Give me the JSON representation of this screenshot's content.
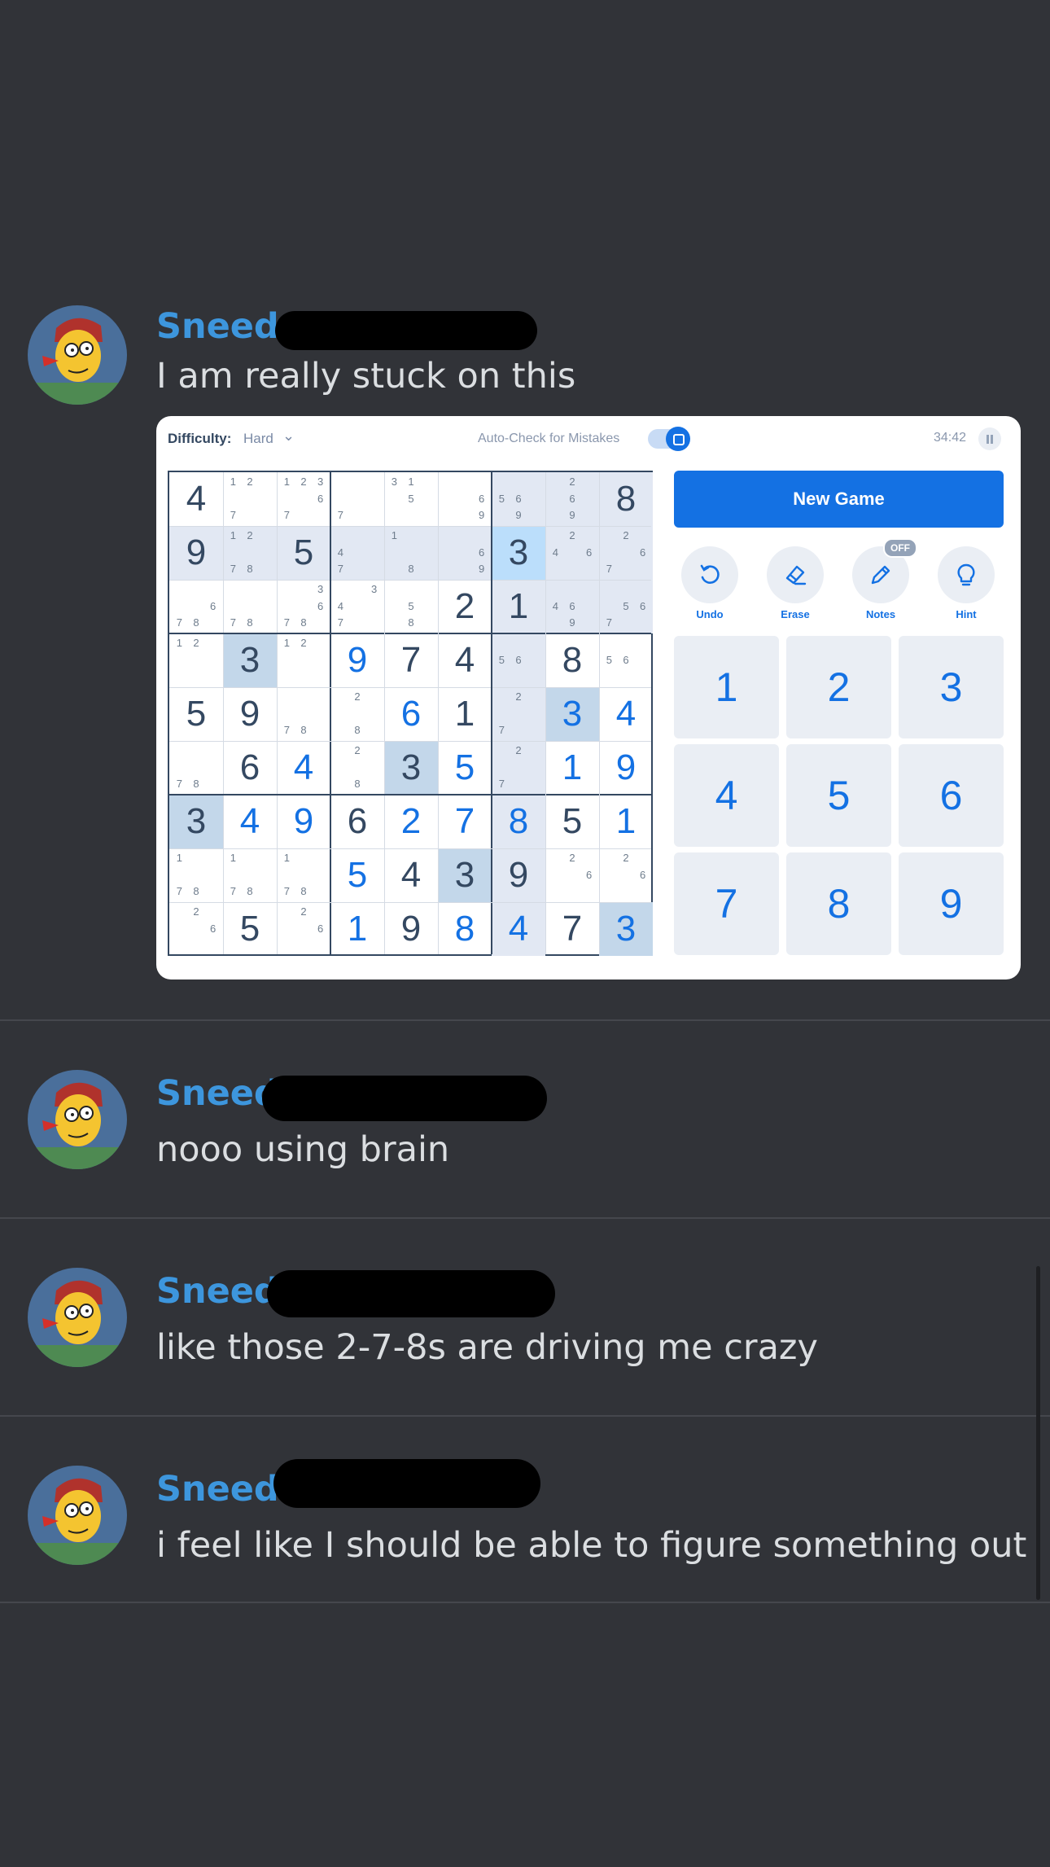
{
  "messages": [
    {
      "author": "Sneed",
      "text": "I am really stuck on this"
    },
    {
      "author": "Sneed",
      "text": "nooo using brain"
    },
    {
      "author": "Sneed",
      "text": "like those 2-7-8s are driving me crazy"
    },
    {
      "author": "Sneed",
      "text": "i feel like I should be able to figure something out"
    }
  ],
  "sudoku": {
    "difficulty_label": "Difficulty:",
    "difficulty_value": "Hard",
    "auto_check_label": "Auto-Check for Mistakes",
    "timer": "34:42",
    "new_game_label": "New Game",
    "tools": [
      {
        "label": "Undo",
        "icon": "undo-icon"
      },
      {
        "label": "Erase",
        "icon": "eraser-icon"
      },
      {
        "label": "Notes",
        "icon": "pencil-icon",
        "badge": "OFF"
      },
      {
        "label": "Hint",
        "icon": "lightbulb-icon"
      }
    ],
    "numpad": [
      "1",
      "2",
      "3",
      "4",
      "5",
      "6",
      "7",
      "8",
      "9"
    ],
    "colors": {
      "given": "#344861",
      "entered": "#1471e3",
      "highlight": "#e2e8f3",
      "selected_same": "#c3d7ea",
      "selected": "#bbdefb"
    },
    "cells": [
      [
        {
          "v": "4",
          "k": "g"
        },
        {
          "n": [
            "1",
            "2",
            "",
            "",
            "",
            "",
            "7",
            "",
            ""
          ]
        },
        {
          "n": [
            "1",
            "2",
            "3",
            "",
            "",
            "6",
            "7",
            "",
            ""
          ]
        },
        {
          "n": [
            "",
            "",
            "",
            "",
            "",
            "",
            "7",
            "",
            ""
          ]
        },
        {
          "n": [
            "3",
            "1",
            "",
            "",
            "5",
            "",
            "",
            "",
            ""
          ]
        },
        {
          "n": [
            "",
            "",
            "",
            "",
            "",
            "6",
            "",
            "",
            "9"
          ]
        },
        {
          "n": [
            "",
            "",
            "",
            "5",
            "6",
            "",
            "",
            "9",
            ""
          ],
          "bg": "hl"
        },
        {
          "n": [
            "",
            "2",
            "",
            "",
            "6",
            "",
            "",
            "9",
            ""
          ],
          "bg": "hl"
        },
        {
          "v": "8",
          "k": "g",
          "bg": "hl"
        }
      ],
      [
        {
          "v": "9",
          "k": "g",
          "bg": "hl"
        },
        {
          "n": [
            "1",
            "2",
            "",
            "",
            "",
            "",
            "7",
            "8",
            ""
          ],
          "bg": "hl"
        },
        {
          "v": "5",
          "k": "g",
          "bg": "hl"
        },
        {
          "n": [
            "",
            "",
            "",
            "4",
            "",
            "",
            "7",
            "",
            ""
          ],
          "bg": "hl"
        },
        {
          "n": [
            "1",
            "",
            "",
            "",
            "",
            "",
            "",
            "8",
            ""
          ],
          "bg": "hl"
        },
        {
          "n": [
            "",
            "",
            "",
            "",
            "",
            "6",
            "",
            "",
            "9"
          ],
          "bg": "hl"
        },
        {
          "v": "3",
          "k": "g",
          "bg": "sel"
        },
        {
          "n": [
            "",
            "2",
            "",
            "4",
            "",
            "6",
            "",
            "",
            ""
          ],
          "bg": "hl"
        },
        {
          "n": [
            "",
            "2",
            "",
            "",
            "",
            "6",
            "7",
            "",
            ""
          ],
          "bg": "hl"
        }
      ],
      [
        {
          "n": [
            "",
            "",
            "",
            "",
            "",
            "6",
            "7",
            "8",
            ""
          ]
        },
        {
          "n": [
            "",
            "",
            "",
            "",
            "",
            "",
            "7",
            "8",
            ""
          ]
        },
        {
          "n": [
            "",
            "",
            "3",
            "",
            "",
            "6",
            "7",
            "8",
            ""
          ]
        },
        {
          "n": [
            "",
            "",
            "3",
            "4",
            "",
            "",
            "7",
            "",
            ""
          ]
        },
        {
          "n": [
            "",
            "",
            "",
            "",
            "5",
            "",
            "",
            "8",
            ""
          ]
        },
        {
          "v": "2",
          "k": "g"
        },
        {
          "v": "1",
          "k": "g",
          "bg": "hl"
        },
        {
          "n": [
            "",
            "",
            "",
            "4",
            "6",
            "",
            "",
            "9",
            ""
          ],
          "bg": "hl"
        },
        {
          "n": [
            "",
            "",
            "",
            "",
            "5",
            "6",
            "7",
            "",
            ""
          ],
          "bg": "hl"
        }
      ],
      [
        {
          "n": [
            "1",
            "2",
            "",
            "",
            "",
            "",
            "",
            "",
            ""
          ]
        },
        {
          "v": "3",
          "k": "g",
          "bg": "same"
        },
        {
          "n": [
            "1",
            "2",
            "",
            "",
            "",
            "",
            "",
            "",
            ""
          ]
        },
        {
          "v": "9",
          "k": "e"
        },
        {
          "v": "7",
          "k": "g"
        },
        {
          "v": "4",
          "k": "g"
        },
        {
          "n": [
            "",
            "",
            "",
            "5",
            "6",
            "",
            "",
            "",
            ""
          ],
          "bg": "hl"
        },
        {
          "v": "8",
          "k": "g"
        },
        {
          "n": [
            "",
            "",
            "",
            "5",
            "6",
            "",
            "",
            "",
            ""
          ]
        }
      ],
      [
        {
          "v": "5",
          "k": "g"
        },
        {
          "v": "9",
          "k": "g"
        },
        {
          "n": [
            "",
            "",
            "",
            "",
            "",
            "",
            "7",
            "8",
            ""
          ]
        },
        {
          "n": [
            "",
            "2",
            "",
            "",
            "",
            "",
            "",
            "8",
            ""
          ]
        },
        {
          "v": "6",
          "k": "e"
        },
        {
          "v": "1",
          "k": "g"
        },
        {
          "n": [
            "",
            "2",
            "",
            "",
            "",
            "",
            "7",
            "",
            ""
          ],
          "bg": "hl"
        },
        {
          "v": "3",
          "k": "e",
          "bg": "same"
        },
        {
          "v": "4",
          "k": "e"
        }
      ],
      [
        {
          "n": [
            "",
            "",
            "",
            "",
            "",
            "",
            "7",
            "8",
            ""
          ]
        },
        {
          "v": "6",
          "k": "g"
        },
        {
          "v": "4",
          "k": "e"
        },
        {
          "n": [
            "",
            "2",
            "",
            "",
            "",
            "",
            "",
            "8",
            ""
          ]
        },
        {
          "v": "3",
          "k": "g",
          "bg": "same"
        },
        {
          "v": "5",
          "k": "e"
        },
        {
          "n": [
            "",
            "2",
            "",
            "",
            "",
            "",
            "7",
            "",
            ""
          ],
          "bg": "hl"
        },
        {
          "v": "1",
          "k": "e"
        },
        {
          "v": "9",
          "k": "e"
        }
      ],
      [
        {
          "v": "3",
          "k": "g",
          "bg": "same"
        },
        {
          "v": "4",
          "k": "e"
        },
        {
          "v": "9",
          "k": "e"
        },
        {
          "v": "6",
          "k": "g"
        },
        {
          "v": "2",
          "k": "e"
        },
        {
          "v": "7",
          "k": "e"
        },
        {
          "v": "8",
          "k": "e",
          "bg": "hl"
        },
        {
          "v": "5",
          "k": "g"
        },
        {
          "v": "1",
          "k": "e"
        }
      ],
      [
        {
          "n": [
            "1",
            "",
            "",
            "",
            "",
            "",
            "7",
            "8",
            ""
          ]
        },
        {
          "n": [
            "1",
            "",
            "",
            "",
            "",
            "",
            "7",
            "8",
            ""
          ]
        },
        {
          "n": [
            "1",
            "",
            "",
            "",
            "",
            "",
            "7",
            "8",
            ""
          ]
        },
        {
          "v": "5",
          "k": "e"
        },
        {
          "v": "4",
          "k": "g"
        },
        {
          "v": "3",
          "k": "g",
          "bg": "same"
        },
        {
          "v": "9",
          "k": "g",
          "bg": "hl"
        },
        {
          "n": [
            "",
            "2",
            "",
            "",
            "",
            "6",
            "",
            "",
            ""
          ]
        },
        {
          "n": [
            "",
            "2",
            "",
            "",
            "",
            "6",
            "",
            "",
            ""
          ]
        }
      ],
      [
        {
          "n": [
            "",
            "2",
            "",
            "",
            "",
            "6",
            "",
            "",
            ""
          ]
        },
        {
          "v": "5",
          "k": "g"
        },
        {
          "n": [
            "",
            "2",
            "",
            "",
            "",
            "6",
            "",
            "",
            ""
          ]
        },
        {
          "v": "1",
          "k": "e"
        },
        {
          "v": "9",
          "k": "g"
        },
        {
          "v": "8",
          "k": "e"
        },
        {
          "v": "4",
          "k": "e",
          "bg": "hl"
        },
        {
          "v": "7",
          "k": "g"
        },
        {
          "v": "3",
          "k": "e",
          "bg": "same"
        }
      ]
    ]
  }
}
